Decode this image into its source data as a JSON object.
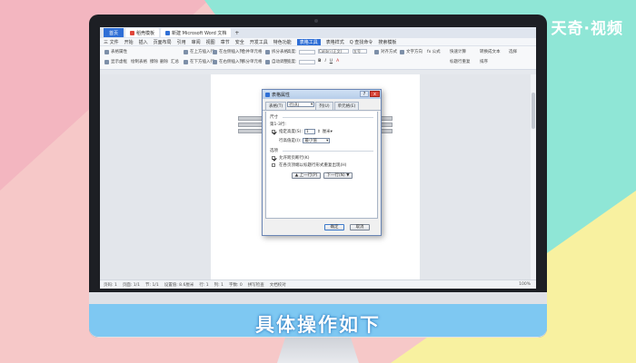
{
  "watermark": "天奇·视频",
  "caption": "具体操作如下",
  "wps": {
    "tabs": [
      "首页",
      "稻壳模板",
      "新建 Microsoft Word 文档"
    ],
    "menu": [
      "三 文件",
      "开始",
      "插入",
      "页面布局",
      "引用",
      "审阅",
      "视图",
      "章节",
      "安全",
      "开发工具",
      "特色功能",
      "表格工具",
      "表格样式",
      "Q 查找命令",
      "搜索模板"
    ],
    "toolbar": {
      "table_props": "表格属性",
      "show_grid": "显示虚框",
      "draw_table": "绘制表格",
      "eraser": "擦除",
      "delete": "删除",
      "summary": "汇总",
      "insert_above": "在上方插入行",
      "insert_below": "在下方插入行",
      "insert_left": "在左侧插入列",
      "insert_right": "在右侧插入列",
      "merge": "合并单元格",
      "split_cell": "拆分单元格",
      "split_table": "拆分表格",
      "auto_fit": "自动调整",
      "height_label": "高度:",
      "width_label": "宽度:",
      "font": "Calibri (正文)",
      "font_size": "五号",
      "align": "对齐方式",
      "text_dir": "文字方向",
      "fx": "fx 公式",
      "quick_calc": "快速计算",
      "title_repeat": "标题行重复",
      "to_text": "转换成文本",
      "sort": "排序",
      "select": "选择"
    },
    "status": [
      "页码: 1",
      "页面: 1/1",
      "节: 1/1",
      "设置值: 8.6厘米",
      "行: 1",
      "列: 1",
      "字数: 0",
      "拼写检查",
      "文档校对"
    ],
    "zoom": "100%"
  },
  "dialog": {
    "title": "表格属性",
    "help": "?",
    "close": "x",
    "tabs": [
      "表格(T)",
      "行(R)",
      "列(U)",
      "单元格(E)"
    ],
    "size_section": "尺寸",
    "row_label": "第1-3行:",
    "specify_height_label": "指定高度(S):",
    "height_value": "1",
    "unit": "厘米▾",
    "row_height_is_label": "行高值是(I):",
    "row_height_value": "最小值",
    "options_section": "选项",
    "allow_break_label": "允许跨页断行(K)",
    "repeat_header_label": "在各页顶端以标题行形式重复出现(H)",
    "prev_row": "▲ 上一行(P)",
    "next_row": "下一行(N) ▼",
    "ok": "确定",
    "cancel": "取消"
  }
}
